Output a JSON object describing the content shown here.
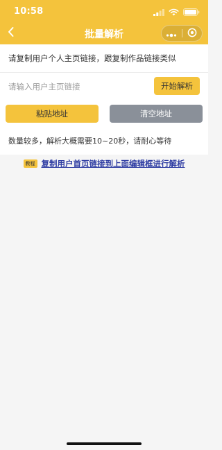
{
  "status_bar": {
    "time": "10:58"
  },
  "nav": {
    "title": "批量解析",
    "back_icon": "chevron-left-icon",
    "menu_icon": "more-dots-icon",
    "close_icon": "target-circle-icon"
  },
  "instruction": {
    "text": "请复制用户个人主页链接，跟复制作品链接类似"
  },
  "url_input": {
    "value": "",
    "placeholder": "请输入用户主页链接"
  },
  "buttons": {
    "start_label": "开始解析",
    "paste_label": "粘贴地址",
    "clear_label": "清空地址"
  },
  "note": {
    "text": "数量较多，解析大概需要10~20秒，请耐心等待"
  },
  "tutorial": {
    "badge": "教程",
    "link_text": "复制用户首页链接到上面编辑框进行解析"
  },
  "colors": {
    "accent": "#f4c33c",
    "secondary_button": "#8a9099",
    "link": "#2f3da3",
    "background": "#f5f5f5"
  }
}
